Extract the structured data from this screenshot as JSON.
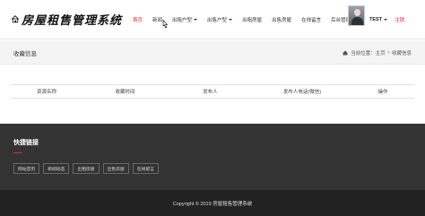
{
  "header": {
    "logo_text": "房屋租售管理系统",
    "nav": [
      {
        "label": "首页",
        "active": true,
        "dropdown": false
      },
      {
        "label": "新闻",
        "active": false,
        "dropdown": false
      },
      {
        "label": "出租户型",
        "active": false,
        "dropdown": true
      },
      {
        "label": "出售户型",
        "active": false,
        "dropdown": true
      },
      {
        "label": "出租房屋",
        "active": false,
        "dropdown": false
      },
      {
        "label": "出售房屋",
        "active": false,
        "dropdown": false
      },
      {
        "label": "在线留言",
        "active": false,
        "dropdown": false
      },
      {
        "label": "后台管理",
        "active": false,
        "dropdown": false
      }
    ],
    "user_name": "TEST",
    "logout_label": "注销"
  },
  "breadcrumb": {
    "title": "收藏信息",
    "location_label": "当前位置：",
    "home": "主页",
    "separator": ">",
    "current": "收藏信息"
  },
  "table": {
    "columns": [
      "资源名称",
      "收藏时间",
      "发布人",
      "发布人电话(微信)",
      "操作"
    ]
  },
  "footer": {
    "quick_title": "快捷链接",
    "quick_links": [
      "网站首页",
      "新闻动态",
      "出租房屋",
      "出售房屋",
      "在线留言"
    ],
    "copyright": "Copyright © 2019 房屋租售管理系统"
  },
  "colors": {
    "accent": "#d9272d",
    "footer_bg": "#333333",
    "copyright_bg": "#222222"
  }
}
